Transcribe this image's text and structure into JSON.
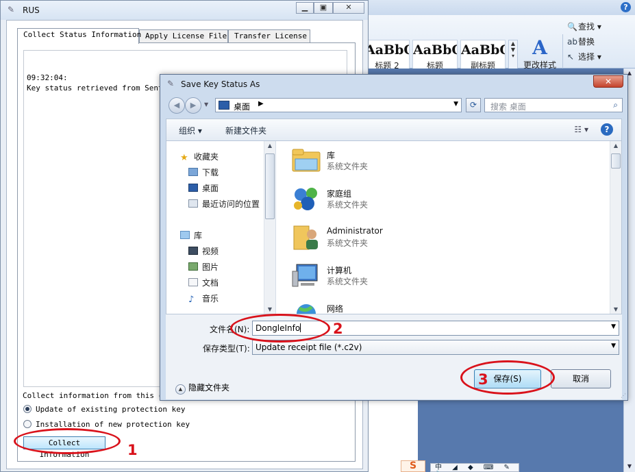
{
  "rus": {
    "title": "RUS",
    "tabs": [
      "Collect Status Information",
      "Apply License File",
      "Transfer License"
    ],
    "log_lines": [
      "09:32:04:",
      "Key status retrieved from Sentine"
    ],
    "collect_label": "Collect information from this comp",
    "options": [
      {
        "label": "Update of existing protection key",
        "selected": true
      },
      {
        "label": "Installation of new protection key",
        "selected": false
      }
    ],
    "collect_button": "Collect Information"
  },
  "word": {
    "styles": [
      {
        "sample": "AaBbC",
        "caption": "标题 2"
      },
      {
        "sample": "AaBbC",
        "caption": "标题"
      },
      {
        "sample": "AaBbC",
        "caption": "副标题"
      }
    ],
    "change_styles": "更改样式",
    "editing": [
      "查找 ▾",
      "替换",
      "选择 ▾"
    ],
    "ime_label": "S",
    "langbar": "中 ◢ ◆ ⌨ ✎ 🔧"
  },
  "dialog": {
    "title": "Save Key Status As",
    "address": "桌面",
    "search_placeholder": "搜索 桌面",
    "toolbar": {
      "organize": "组织 ▾",
      "new_folder": "新建文件夹"
    },
    "nav": {
      "favorites": "收藏夹",
      "fav_items": [
        "下载",
        "桌面",
        "最近访问的位置"
      ],
      "libraries": "库",
      "lib_items": [
        "视频",
        "图片",
        "文档",
        "音乐"
      ]
    },
    "items": [
      {
        "name": "库",
        "type": "系统文件夹"
      },
      {
        "name": "家庭组",
        "type": "系统文件夹"
      },
      {
        "name": "Administrator",
        "type": "系统文件夹"
      },
      {
        "name": "计算机",
        "type": "系统文件夹"
      },
      {
        "name": "网络",
        "type": ""
      }
    ],
    "filename_label": "文件名(N):",
    "filename_value": "DongleInfo",
    "filetype_label": "保存类型(T):",
    "filetype_value": "Update receipt file (*.c2v)",
    "hide_folders": "隐藏文件夹",
    "save_button": "保存(S)",
    "cancel_button": "取消"
  },
  "annotations": {
    "step1": "1",
    "step2": "2",
    "step3": "3",
    "color": "#d9121b"
  }
}
